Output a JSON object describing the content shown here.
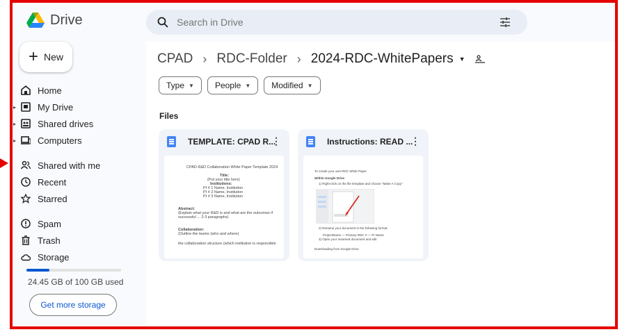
{
  "app": {
    "name": "Drive",
    "colors": {
      "annotation_border": "#e60000",
      "accent": "#0b57d0"
    }
  },
  "search": {
    "placeholder": "Search in Drive",
    "icon": "search-icon",
    "options_icon": "tune-icon"
  },
  "new_button": {
    "label": "New"
  },
  "nav": {
    "home": "Home",
    "my_drive": "My Drive",
    "shared_drives": "Shared drives",
    "computers": "Computers",
    "shared_with_me": "Shared with me",
    "recent": "Recent",
    "starred": "Starred",
    "spam": "Spam",
    "trash": "Trash",
    "storage": "Storage"
  },
  "storage": {
    "used_text": "24.45 GB of 100 GB used",
    "used_fraction": 0.2445,
    "button_label": "Get more storage"
  },
  "breadcrumb": {
    "parts": [
      "CPAD",
      "RDC-Folder"
    ],
    "separator": "›",
    "current": "2024-RDC-WhitePapers"
  },
  "filters": {
    "type": "Type",
    "people": "People",
    "modified": "Modified"
  },
  "files_label": "Files",
  "files": [
    {
      "title": "TEMPLATE: CPAD R...",
      "preview": {
        "heading": "CPAD R&D Collaboration White Paper Template 2024",
        "title_label": "Title:",
        "title_hint": "(Put your title here)",
        "institutions_label": "Institutions:",
        "pi1": "PI # 1 Name, Institution",
        "pi2": "PI # 2 Name, Institution",
        "pi3": "PI # 3 Name, Institution",
        "abstract_label": "Abstract:",
        "abstract_text1": "(Explain what your R&D is and what are the outcomes if",
        "abstract_text2": "successful ... 2-3 paragraphs)",
        "collab_label": "Collaboration:",
        "collab_text": "(Outline the teams (who and where)",
        "collab_text2": "the collaboration structure (which institution is responsible"
      }
    },
    {
      "title": "Instructions: READ ...",
      "preview": {
        "line1": "To create your own RDC White Paper",
        "line2": "Within Google Drive",
        "line3": "1) Right-click on the file template and choose \"Make A Copy\"",
        "line4": "2) Rename your document in the following format:",
        "line5": "ProjectName — Primary RDC # — PI Name",
        "line6": "3) Open your renamed document and edit",
        "line7": "Downloading from Google Drive"
      }
    }
  ]
}
